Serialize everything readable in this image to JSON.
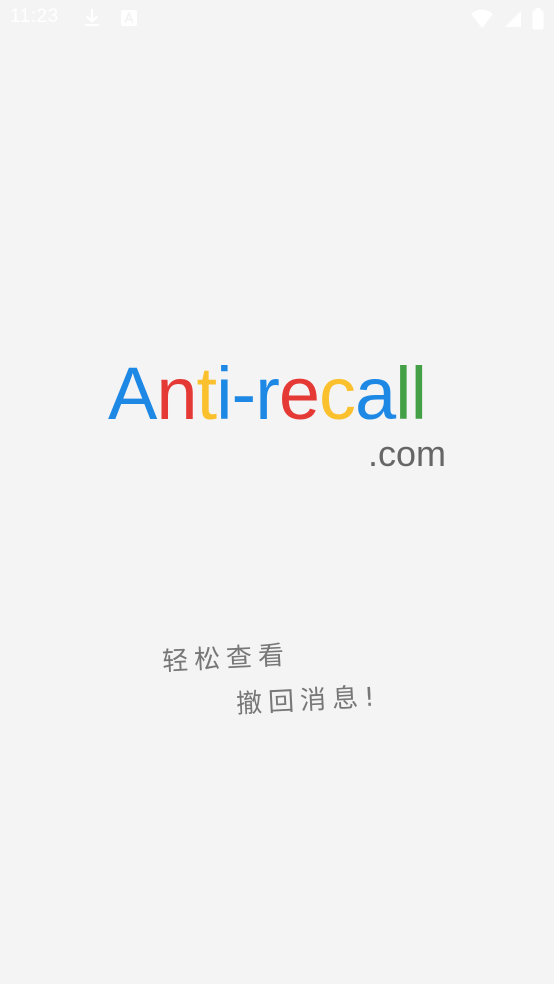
{
  "status_bar": {
    "time": "11:23",
    "left_icons": [
      "download-icon",
      "a-notification-icon"
    ],
    "right_icons": [
      "wifi-icon",
      "cellular-signal-icon",
      "battery-icon"
    ]
  },
  "logo": {
    "letters": [
      {
        "char": "A",
        "color": "#1e88e5"
      },
      {
        "char": "n",
        "color": "#e53935"
      },
      {
        "char": "t",
        "color": "#fbc02d"
      },
      {
        "char": "i",
        "color": "#1e88e5"
      },
      {
        "char": "-",
        "color": "#1e88e5"
      },
      {
        "char": "r",
        "color": "#1e88e5"
      },
      {
        "char": "e",
        "color": "#e53935"
      },
      {
        "char": "c",
        "color": "#fbc02d"
      },
      {
        "char": "a",
        "color": "#1e88e5"
      },
      {
        "char": "l",
        "color": "#43a047"
      },
      {
        "char": "l",
        "color": "#43a047"
      }
    ],
    "suffix": ".com",
    "suffix_color": "#666666"
  },
  "slogan": {
    "line1": "轻松查看",
    "line2": "撤回消息!",
    "color": "#777777"
  },
  "background_color": "#f4f4f4"
}
